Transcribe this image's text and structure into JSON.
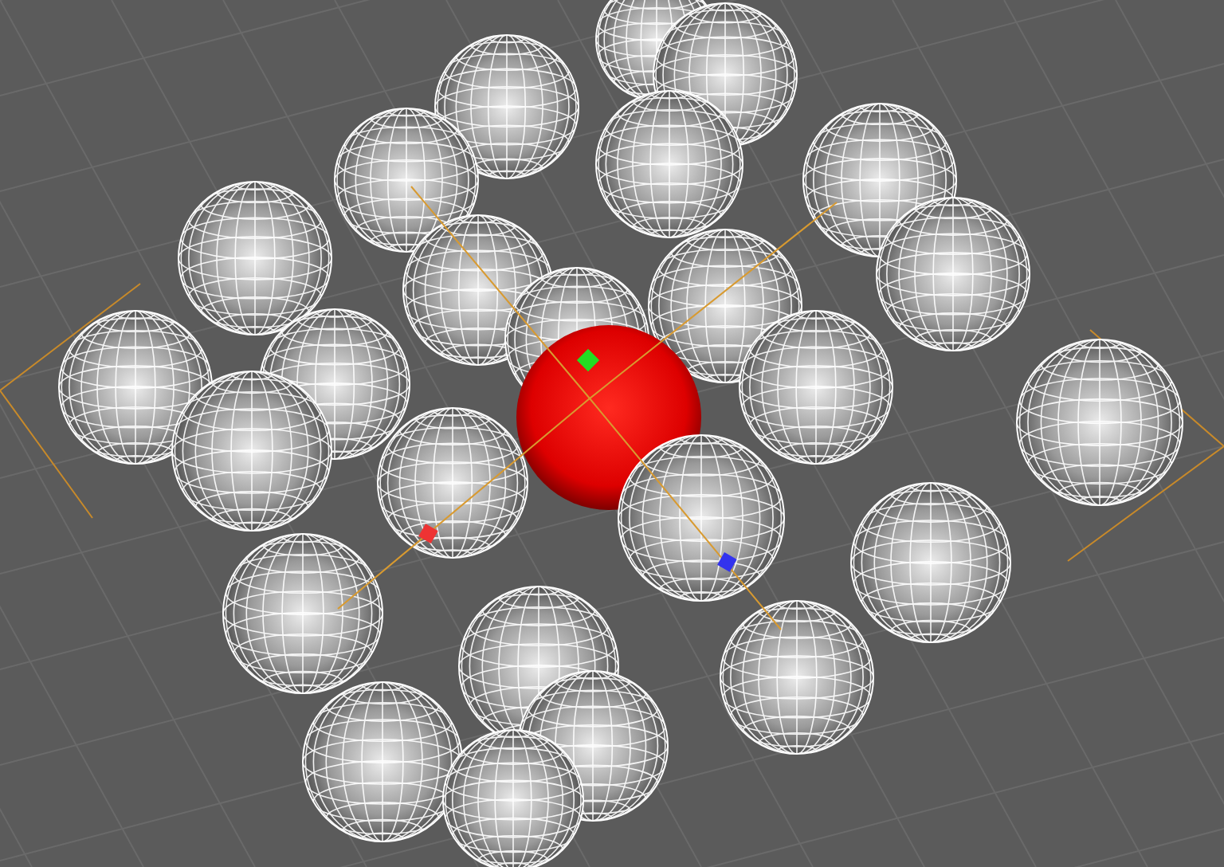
{
  "viewport": {
    "spheres": [
      {
        "selected": false
      },
      {
        "selected": false
      },
      {
        "selected": false
      },
      {
        "selected": false
      },
      {
        "selected": false
      },
      {
        "selected": false
      },
      {
        "selected": false
      },
      {
        "selected": false
      },
      {
        "selected": false
      },
      {
        "selected": false
      },
      {
        "selected": false
      },
      {
        "selected": false
      },
      {
        "selected": false
      },
      {
        "selected": false
      },
      {
        "selected": false
      },
      {
        "selected": false
      },
      {
        "selected": false
      },
      {
        "selected": true
      },
      {
        "selected": false
      },
      {
        "selected": false
      },
      {
        "selected": false
      },
      {
        "selected": false
      },
      {
        "selected": false
      },
      {
        "selected": false
      },
      {
        "selected": false
      },
      {
        "selected": false
      }
    ]
  }
}
